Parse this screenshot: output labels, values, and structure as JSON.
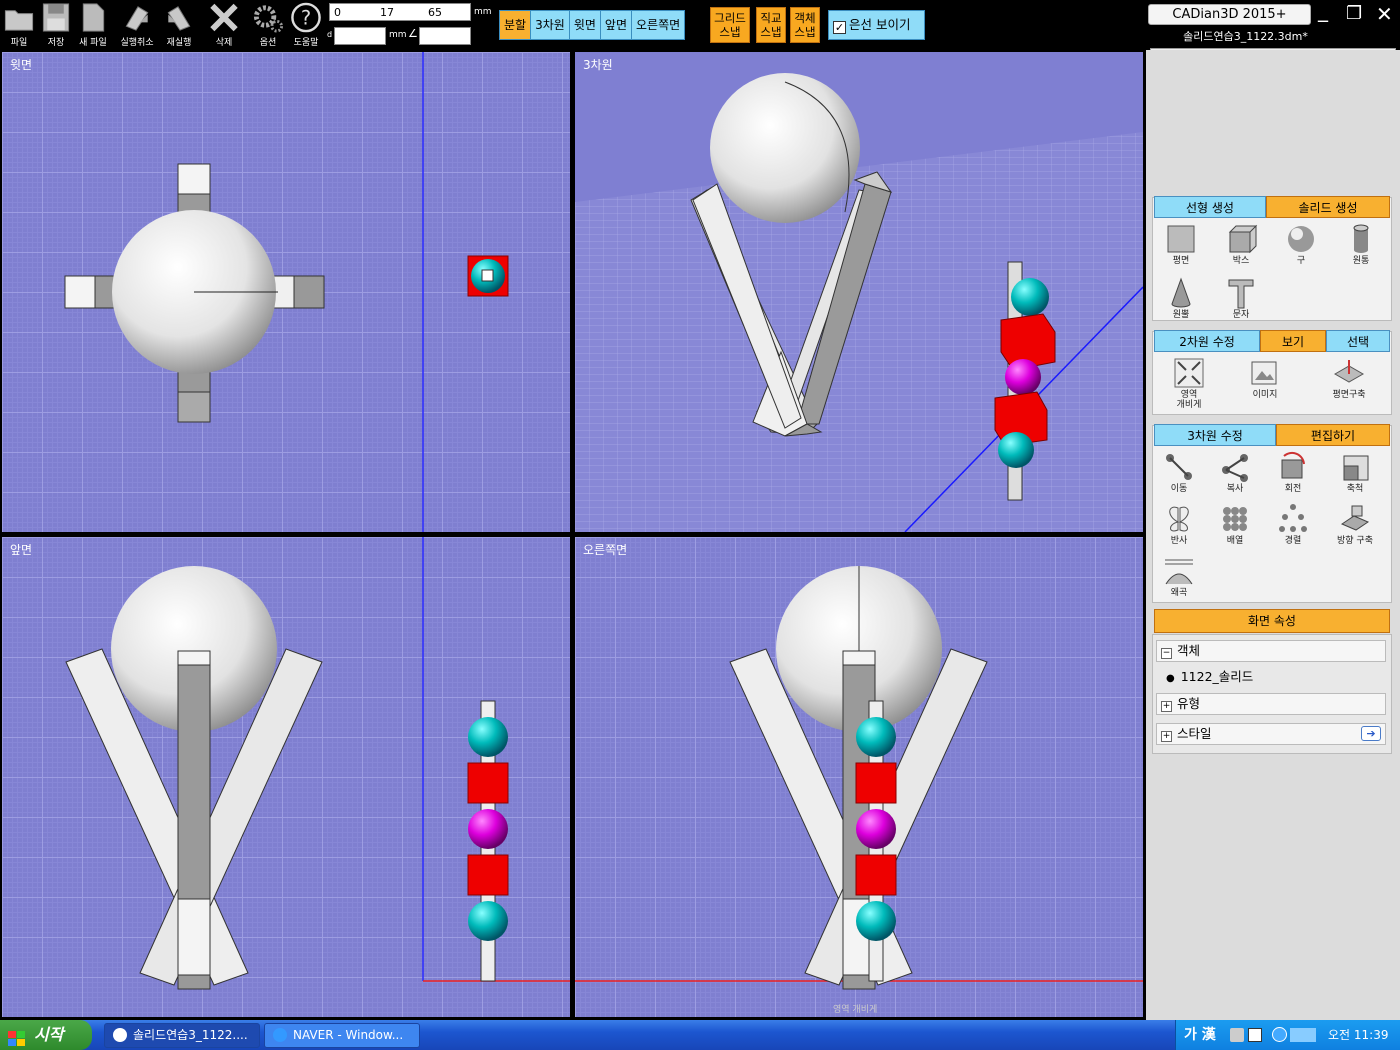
{
  "toolbar": {
    "buttons": [
      {
        "label": "파일",
        "icon": "folder-icon"
      },
      {
        "label": "저장",
        "icon": "save-icon"
      },
      {
        "label": "새 파일",
        "icon": "new-file-icon"
      },
      {
        "label": "실행취소",
        "icon": "undo-icon"
      },
      {
        "label": "재실행",
        "icon": "redo-icon"
      },
      {
        "label": "삭제",
        "icon": "delete-icon"
      },
      {
        "label": "옵션",
        "icon": "gear-icon"
      },
      {
        "label": "도움말",
        "icon": "help-icon"
      }
    ],
    "coord_x": "0",
    "coord_y": "17",
    "coord_z": "65",
    "unit": "mm",
    "dist_label": "d",
    "unit2": "mm",
    "angle_symbol": "∠"
  },
  "view_tabs": [
    "분할",
    "3차원",
    "윗면",
    "앞면",
    "오른쪽면"
  ],
  "snaps": [
    {
      "line1": "그리드",
      "line2": "스냅"
    },
    {
      "line1": "직교",
      "line2": "스냅"
    },
    {
      "line1": "객체",
      "line2": "스냅"
    }
  ],
  "hidden_lines": {
    "label": "은선 보이기",
    "checked": true,
    "check": "✓"
  },
  "window": {
    "title": "CADian3D 2015+",
    "file": "솔리드연습3_1122.3dm*",
    "minimize": "_",
    "restore": "❐",
    "close": "✕"
  },
  "viewports": {
    "top": "윗면",
    "persp": "3차원",
    "front": "앞면",
    "right": "오른쪽면",
    "right_bottom_text": "영역 개비게"
  },
  "panel": {
    "create_tabs": [
      "선형 생성",
      "솔리드 생성"
    ],
    "create_items": [
      {
        "label": "평면",
        "icon": "plane-icon"
      },
      {
        "label": "박스",
        "icon": "box-icon"
      },
      {
        "label": "구",
        "icon": "sphere-icon"
      },
      {
        "label": "원통",
        "icon": "cylinder-icon"
      },
      {
        "label": "원뿔",
        "icon": "cone-icon"
      },
      {
        "label": "문자",
        "icon": "text-icon"
      }
    ],
    "edit2d_tabs": [
      "2차원 수정",
      "보기",
      "선택"
    ],
    "edit2d_items": [
      {
        "label": "영역\n개비게",
        "icon": "zoom-extents-icon"
      },
      {
        "label": "이미지",
        "icon": "image-icon"
      },
      {
        "label": "평면구축",
        "icon": "construction-plane-icon"
      }
    ],
    "edit3d_tabs": [
      "3차원 수정",
      "편집하기"
    ],
    "edit3d_items": [
      {
        "label": "이동",
        "icon": "move-icon"
      },
      {
        "label": "복사",
        "icon": "copy-icon"
      },
      {
        "label": "회전",
        "icon": "rotate-icon"
      },
      {
        "label": "축척",
        "icon": "scale-icon"
      },
      {
        "label": "반사",
        "icon": "mirror-icon"
      },
      {
        "label": "배열",
        "icon": "array-icon"
      },
      {
        "label": "경렬",
        "icon": "align-icon"
      },
      {
        "label": "방향 구축",
        "icon": "orient-icon"
      },
      {
        "label": "왜곡",
        "icon": "distort-icon"
      }
    ],
    "props_title": "화면 속성",
    "props": {
      "object": "객체",
      "object_name": "1122_솔리드",
      "type": "유형",
      "style": "스타일",
      "collapse": "−",
      "expand": "+"
    }
  },
  "taskbar": {
    "start": "시작",
    "tasks": [
      "솔리드연습3_1122....",
      "NAVER - Window..."
    ],
    "ime": "가 漢",
    "time": "오전 11:39"
  }
}
